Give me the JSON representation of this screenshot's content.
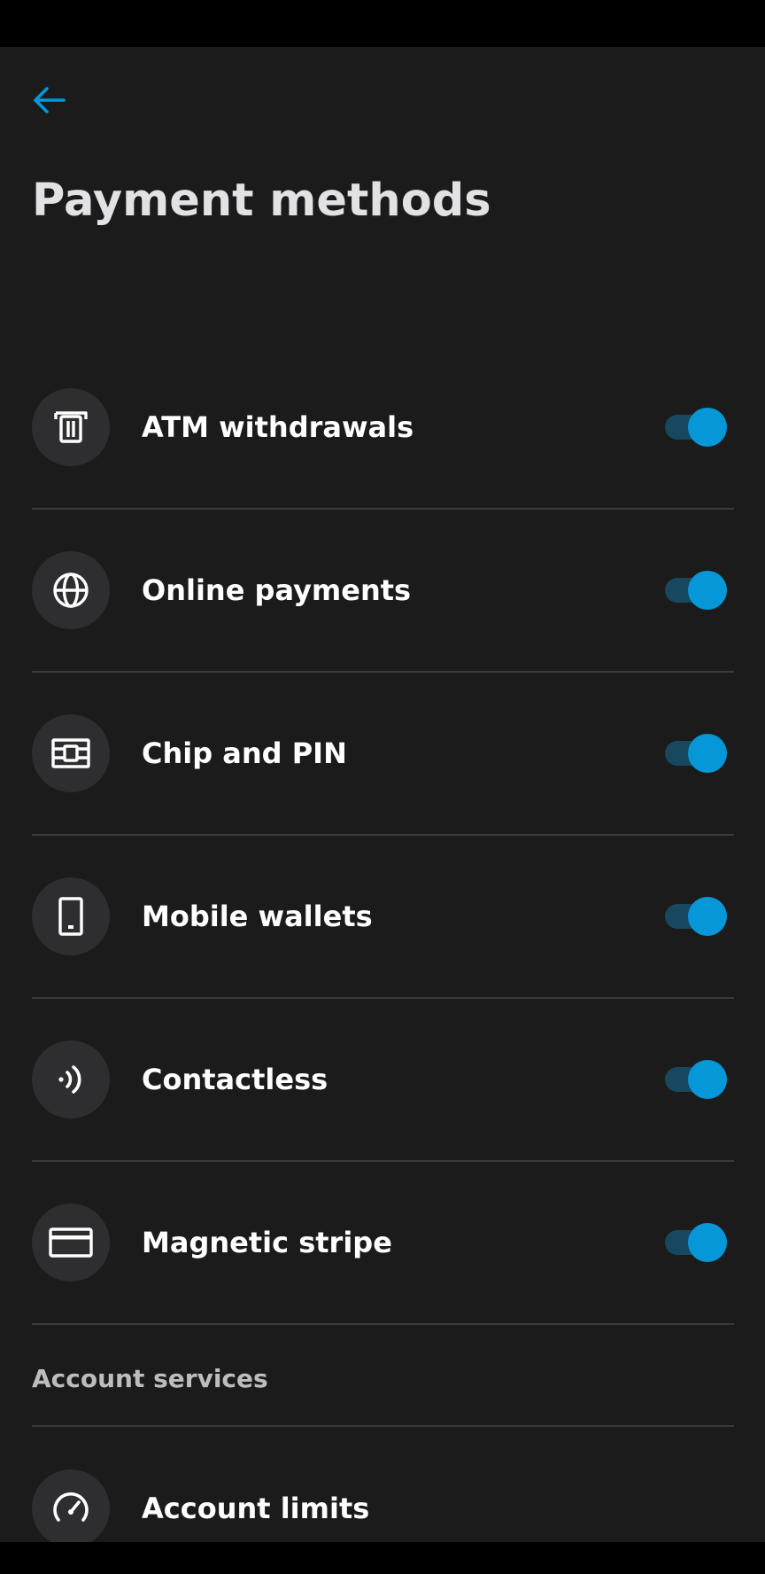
{
  "header": {
    "back_label": "",
    "title": "Payment methods"
  },
  "payment_methods": [
    {
      "label": "ATM withdrawals",
      "icon": "atm-icon",
      "enabled": true
    },
    {
      "label": "Online payments",
      "icon": "globe-icon",
      "enabled": true
    },
    {
      "label": "Chip and PIN",
      "icon": "chip-icon",
      "enabled": true
    },
    {
      "label": "Mobile wallets",
      "icon": "phone-icon",
      "enabled": true
    },
    {
      "label": "Contactless",
      "icon": "contactless-icon",
      "enabled": true
    },
    {
      "label": "Magnetic stripe",
      "icon": "card-icon",
      "enabled": true
    }
  ],
  "account_services": {
    "header": "Account services",
    "items": [
      {
        "label": "Account limits",
        "icon": "speedometer-icon"
      }
    ]
  },
  "colors": {
    "accent": "#0697d8",
    "toggle_track": "#17485f",
    "background": "#1b1b1c",
    "icon_circle": "#2e2e30",
    "divider": "#3a3a3c"
  }
}
